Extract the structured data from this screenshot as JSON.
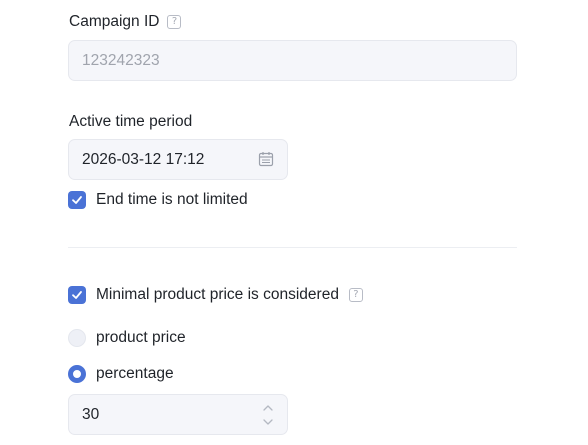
{
  "campaign_id": {
    "label": "Campaign ID",
    "help_icon": "question-icon",
    "value": "123242323"
  },
  "active_period": {
    "label": "Active time period",
    "value": "2026-03-12 17:12",
    "icon": "calendar-icon",
    "end_unlimited": {
      "label": "End time is not limited",
      "checked": true
    }
  },
  "min_price": {
    "label": "Minimal product price is considered",
    "checked": true,
    "help_icon": "question-icon",
    "options": [
      {
        "label": "product price",
        "selected": false
      },
      {
        "label": "percentage",
        "selected": true
      }
    ],
    "percentage_value": "30"
  },
  "colors": {
    "accent": "#4a72d6",
    "input_bg": "#f5f6fa",
    "text": "#1f2329",
    "muted": "#a0a4ad"
  }
}
